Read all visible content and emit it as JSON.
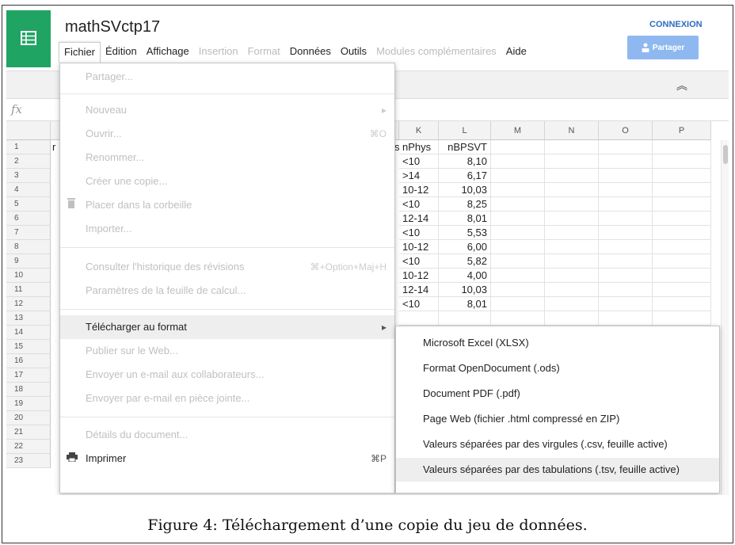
{
  "app": {
    "title": "mathSVctp17",
    "connexion": "CONNEXION",
    "share_label": "Partager",
    "fx_label": "fx",
    "brand_color": "#1fa463",
    "accent_color": "#2d6cc0"
  },
  "menubar": [
    {
      "label": "Fichier",
      "state": "active"
    },
    {
      "label": "Édition",
      "state": "enabled"
    },
    {
      "label": "Affichage",
      "state": "enabled"
    },
    {
      "label": "Insertion",
      "state": "disabled"
    },
    {
      "label": "Format",
      "state": "disabled"
    },
    {
      "label": "Données",
      "state": "enabled"
    },
    {
      "label": "Outils",
      "state": "enabled"
    },
    {
      "label": "Modules complémentaires",
      "state": "disabled"
    },
    {
      "label": "Aide",
      "state": "enabled"
    }
  ],
  "grid": {
    "columns": [
      "K",
      "L",
      "M",
      "N",
      "O",
      "P"
    ],
    "rows": [
      "1",
      "2",
      "3",
      "4",
      "5",
      "6",
      "7",
      "8",
      "9",
      "10",
      "11",
      "12",
      "13",
      "14",
      "15",
      "16",
      "17",
      "18",
      "19",
      "20",
      "21",
      "22",
      "23"
    ],
    "col_j_fragment": "s",
    "row1_fragment": "r",
    "header": [
      "nPhys",
      "nBPSVT"
    ],
    "data": [
      [
        "<10",
        "8,10"
      ],
      [
        ">14",
        "6,17"
      ],
      [
        "10-12",
        "10,03"
      ],
      [
        "<10",
        "8,25"
      ],
      [
        "12-14",
        "8,01"
      ],
      [
        "<10",
        "5,53"
      ],
      [
        "10-12",
        "6,00"
      ],
      [
        "<10",
        "5,82"
      ],
      [
        "10-12",
        "4,00"
      ],
      [
        "12-14",
        "10,03"
      ],
      [
        "<10",
        "8,01"
      ]
    ]
  },
  "file_menu": {
    "share": "Partager...",
    "new": "Nouveau",
    "open": "Ouvrir...",
    "open_shortcut": "⌘O",
    "rename": "Renommer...",
    "copy": "Créer une copie...",
    "trash": "Placer dans la corbeille",
    "import": "Importer...",
    "history": "Consulter l'historique des révisions",
    "history_shortcut": "⌘+Option+Maj+H",
    "settings": "Paramètres de la feuille de calcul...",
    "download": "Télécharger au format",
    "publish": "Publier sur le Web...",
    "email_collab": "Envoyer un e-mail aux collaborateurs...",
    "email_attach": "Envoyer par e-mail en pièce jointe...",
    "details": "Détails du document...",
    "print": "Imprimer",
    "print_shortcut": "⌘P"
  },
  "download_menu": [
    "Microsoft Excel (XLSX)",
    "Format OpenDocument (.ods)",
    "Document PDF (.pdf)",
    "Page Web (fichier .html compressé en ZIP)",
    "Valeurs séparées par des virgules (.csv, feuille active)",
    "Valeurs séparées par des tabulations (.tsv, feuille active)"
  ],
  "caption": "Figure 4: Téléchargement d’une copie du jeu de données."
}
